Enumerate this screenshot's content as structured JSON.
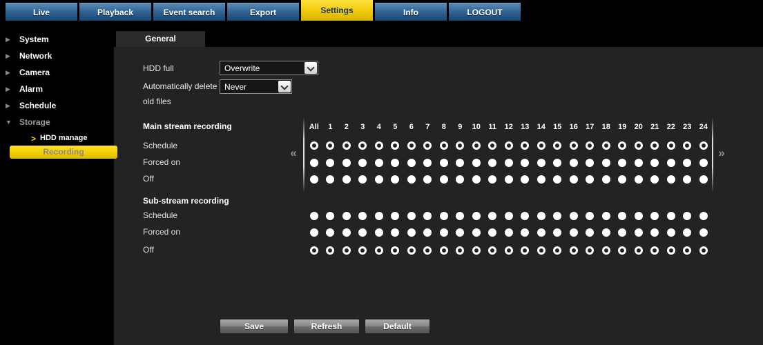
{
  "nav": {
    "items": [
      {
        "label": "Live",
        "active": false
      },
      {
        "label": "Playback",
        "active": false
      },
      {
        "label": "Event search",
        "active": false
      },
      {
        "label": "Export",
        "active": false
      },
      {
        "label": "Settings",
        "active": true
      },
      {
        "label": "Info",
        "active": false
      },
      {
        "label": "LOGOUT",
        "active": false
      }
    ]
  },
  "sidebar": {
    "items": [
      {
        "label": "System",
        "expanded": false
      },
      {
        "label": "Network",
        "expanded": false
      },
      {
        "label": "Camera",
        "expanded": false
      },
      {
        "label": "Alarm",
        "expanded": false
      },
      {
        "label": "Schedule",
        "expanded": false
      },
      {
        "label": "Storage",
        "expanded": true
      }
    ],
    "sub_items": [
      {
        "marker": ">",
        "label": "HDD manage",
        "selected": false
      },
      {
        "label": "Recording",
        "selected": true
      }
    ]
  },
  "tabs": [
    {
      "label": "General",
      "active": true
    }
  ],
  "form": {
    "hdd_full": {
      "label": "HDD full",
      "value": "Overwrite"
    },
    "auto_delete": {
      "label": "Automatically delete",
      "label2": "old files",
      "value": "Never"
    }
  },
  "recording": {
    "columns": [
      "All",
      "1",
      "2",
      "3",
      "4",
      "5",
      "6",
      "7",
      "8",
      "9",
      "10",
      "11",
      "12",
      "13",
      "14",
      "15",
      "16",
      "17",
      "18",
      "19",
      "20",
      "21",
      "22",
      "23",
      "24"
    ],
    "prev_icon": "«",
    "next_icon": "»",
    "sections": [
      {
        "title": "Main stream recording",
        "rows": [
          {
            "label": "Schedule",
            "selected": true
          },
          {
            "label": "Forced on",
            "selected": false
          },
          {
            "label": "Off",
            "selected": false
          }
        ]
      },
      {
        "title": "Sub-stream recording",
        "rows": [
          {
            "label": "Schedule",
            "selected": false
          },
          {
            "label": "Forced on",
            "selected": false
          },
          {
            "label": "Off",
            "selected": true
          }
        ]
      }
    ]
  },
  "actions": [
    {
      "label": "Save"
    },
    {
      "label": "Refresh"
    },
    {
      "label": "Default"
    }
  ],
  "colors": {
    "accent_yellow": "#f2cf00",
    "nav_blue": "#2c5f8f",
    "content_bg": "#232323",
    "active_tab_text": "#16386e"
  }
}
